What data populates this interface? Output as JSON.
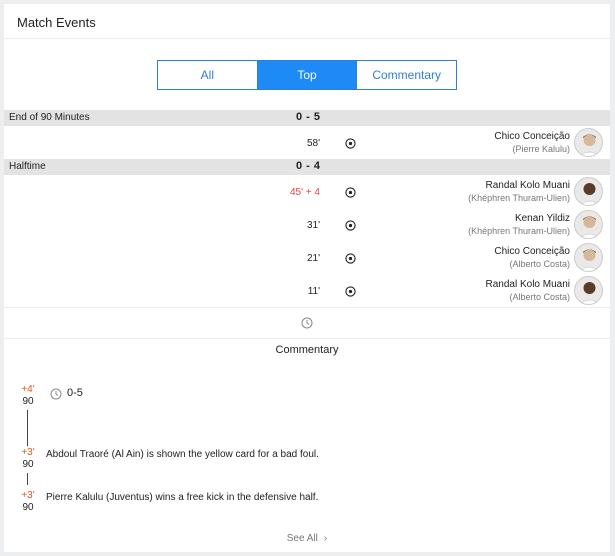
{
  "header": {
    "title": "Match Events"
  },
  "tabs": [
    {
      "label": "All",
      "active": false
    },
    {
      "label": "Top",
      "active": true
    },
    {
      "label": "Commentary",
      "active": false
    }
  ],
  "periods": [
    {
      "label": "End of 90 Minutes",
      "score": "0 - 5",
      "events": [
        {
          "minute": "58'",
          "minute_red": false,
          "player": "Chico Conceição",
          "assist": "(Pierre Kalulu)",
          "icon": "goal-ball-icon"
        }
      ]
    },
    {
      "label": "Halftime",
      "score": "0 - 4",
      "events": [
        {
          "minute": "45' + 4",
          "minute_red": true,
          "player": "Randal Kolo Muani",
          "assist": "(Khéphren Thuram-Ulien)",
          "icon": "goal-ball-icon"
        },
        {
          "minute": "31'",
          "minute_red": false,
          "player": "Kenan Yildiz",
          "assist": "(Khéphren Thuram-Ulien)",
          "icon": "goal-ball-icon"
        },
        {
          "minute": "21'",
          "minute_red": false,
          "player": "Chico Conceição",
          "assist": "(Alberto Costa)",
          "icon": "goal-ball-icon"
        },
        {
          "minute": "11'",
          "minute_red": false,
          "player": "Randal Kolo Muani",
          "assist": "(Alberto Costa)",
          "icon": "goal-ball-icon"
        }
      ]
    }
  ],
  "commentary": {
    "title": "Commentary",
    "items": [
      {
        "added": "+4'",
        "minute": "90",
        "text": "0-5",
        "icon": "clock-icon"
      },
      {
        "added": "+3'",
        "minute": "90",
        "text": "Abdoul Traoré (Al Ain) is shown the yellow card for a bad foul."
      },
      {
        "added": "+3'",
        "minute": "90",
        "text": "Pierre Kalulu (Juventus) wins a free kick in the defensive half."
      }
    ],
    "see_all": "See All"
  },
  "colors": {
    "accent": "#1d8af5",
    "red_minute": "#e04545",
    "added_time": "#e05a1a",
    "period_bg": "#e3e3e3"
  }
}
